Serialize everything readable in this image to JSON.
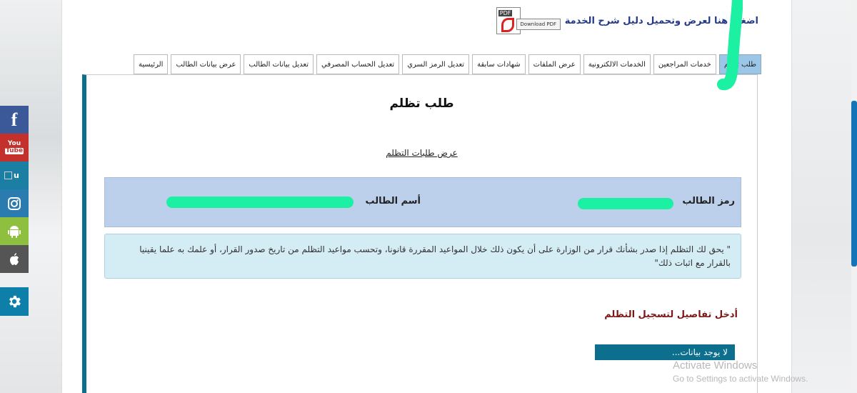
{
  "pdf": {
    "link_text": "اضغط هنا لعرض وتحميل دليل شرح الخدمة",
    "badge": "PDF",
    "button": "Download PDF"
  },
  "tabs": [
    {
      "label": "الرئيسية",
      "active": false
    },
    {
      "label": "عرض بيانات الطالب",
      "active": false
    },
    {
      "label": "تعديل بيانات الطالب",
      "active": false
    },
    {
      "label": "تعديل الحساب المصرفي",
      "active": false
    },
    {
      "label": "تعديل الرمز السري",
      "active": false
    },
    {
      "label": "شهادات سابقة",
      "active": false
    },
    {
      "label": "عرض الملفات",
      "active": false
    },
    {
      "label": "الخدمات الالكترونية",
      "active": false
    },
    {
      "label": "خدمات المراجعين",
      "active": false
    },
    {
      "label": "طلب تظلم",
      "active": true
    }
  ],
  "main": {
    "title": "طلب تظلم",
    "list_link": "عرض طلبات التظلم",
    "student_code_label": "رمز الطالب",
    "student_name_label": "أسم الطالب",
    "notice": "\" يحق لك التظلم إذا صدر بشأنك قرار من الوزارة على أن يكون ذلك خلال المواعيد المقررة قانونا، وتحسب مواعيد التظلم من تاريخ صدور القرار، أو علمك به علما يقينيا بالقرار مع اثبات ذلك\"",
    "section_title": "أدخل تفاصيل لتسجيل التظلم",
    "no_data": "لا يوجد بيانات..."
  },
  "social": {
    "facebook": "f",
    "youtube_1": "You",
    "youtube_2": "Tube",
    "broken": "u"
  },
  "watermark": {
    "line1": "Activate Windows",
    "line2": "Go to Settings to activate Windows."
  },
  "colors": {
    "accent": "#0d6f8e",
    "active_tab": "#9cc6e8",
    "student_box": "#bcd0ec",
    "redaction": "#1cf0a2"
  }
}
